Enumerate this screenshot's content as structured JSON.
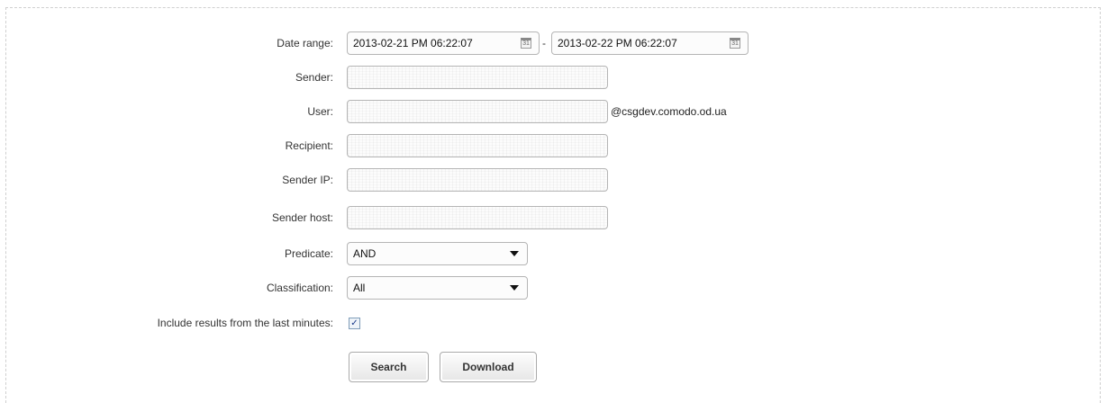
{
  "form": {
    "date_range": {
      "label": "Date range:",
      "from": "2013-02-21 PM 06:22:07",
      "separator": "-",
      "to": "2013-02-22 PM 06:22:07",
      "calendar_glyph": "31"
    },
    "sender": {
      "label": "Sender:",
      "value": ""
    },
    "user": {
      "label": "User:",
      "value": "",
      "suffix": "@csgdev.comodo.od.ua"
    },
    "recipient": {
      "label": "Recipient:",
      "value": ""
    },
    "sender_ip": {
      "label": "Sender IP:",
      "value": ""
    },
    "sender_host": {
      "label": "Sender host:",
      "value": ""
    },
    "predicate": {
      "label": "Predicate:",
      "selected": "AND"
    },
    "classification": {
      "label": "Classification:",
      "selected": "All"
    },
    "include_recent": {
      "label": "Include results from the last minutes:",
      "checked": true,
      "check_glyph": "✓"
    },
    "search_label": "Search",
    "download_label": "Download"
  },
  "icons": {
    "calendar": "calendar-icon",
    "dropdown": "chevron-down-icon",
    "check": "check-icon"
  }
}
